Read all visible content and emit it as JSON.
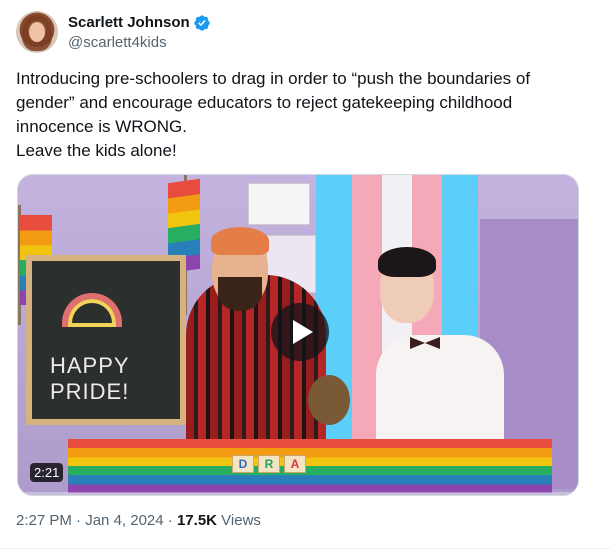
{
  "author": {
    "display_name": "Scarlett Johnson",
    "handle": "@scarlett4kids",
    "verified": true,
    "verified_icon": "verified-badge-icon",
    "verified_color": "#1d9bf0"
  },
  "tweet": {
    "text": "Introducing pre-schoolers to drag in order to “push the boundaries of gender” and encourage educators to reject gatekeeping childhood innocence is WRONG.\nLeave the kids alone!"
  },
  "media": {
    "duration": "2:21",
    "play_icon": "play-icon",
    "chalkboard_text": "HAPPY PRIDE!",
    "blocks": [
      "D",
      "R",
      "A"
    ]
  },
  "meta": {
    "time": "2:27 PM",
    "separator1": " · ",
    "date": "Jan 4, 2024",
    "separator2": " · ",
    "views_count": "17.5K",
    "views_label": " Views"
  }
}
